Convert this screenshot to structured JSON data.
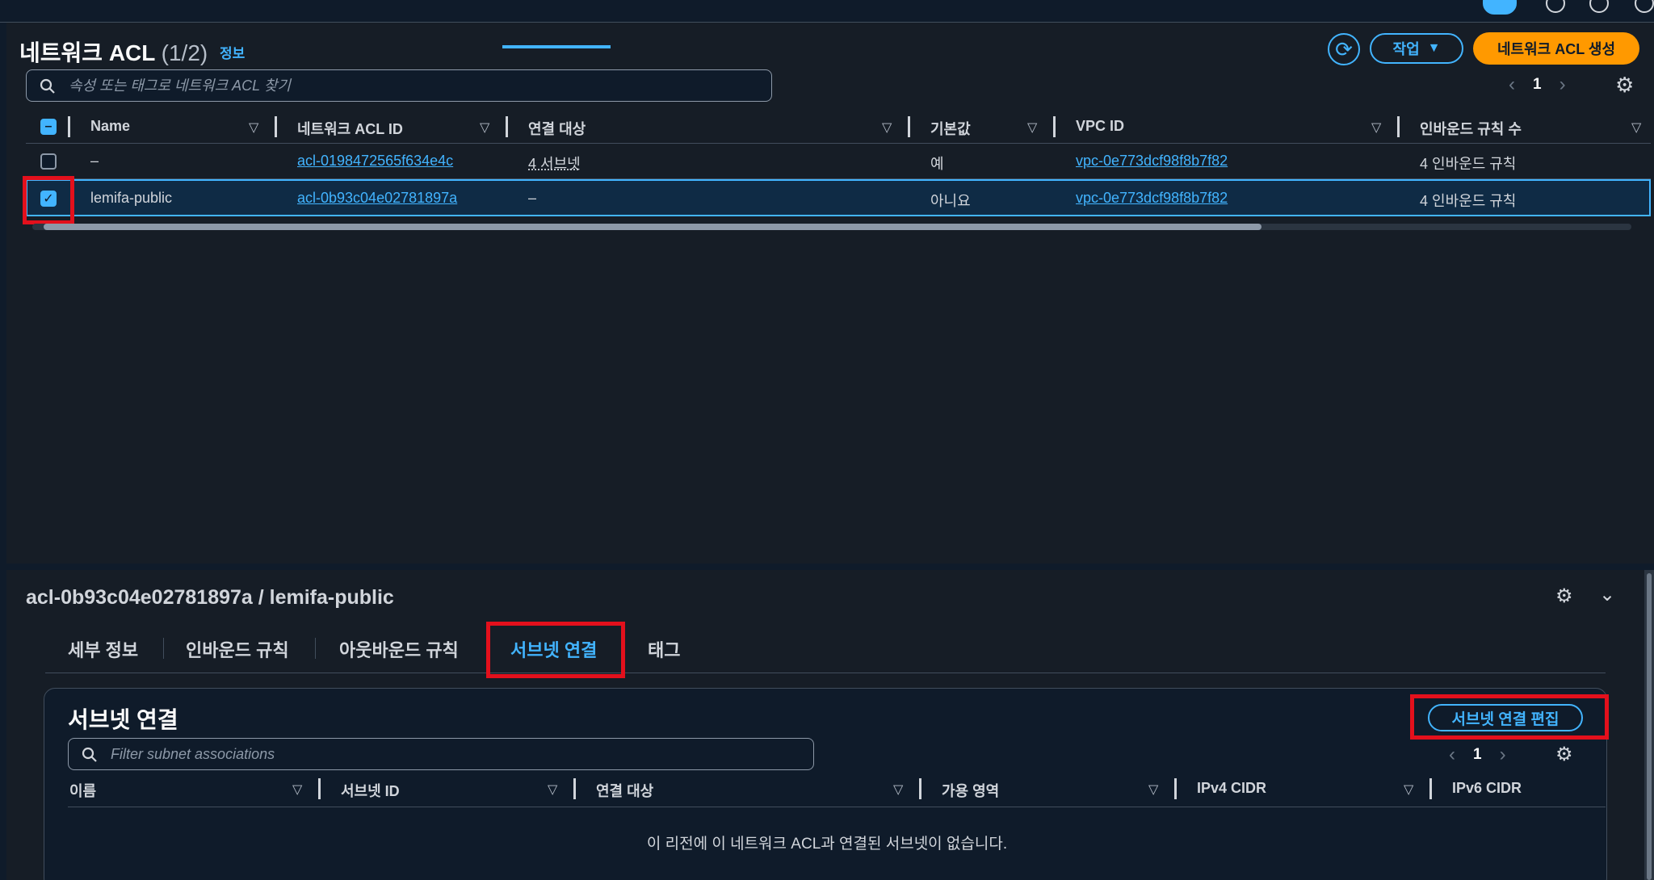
{
  "list": {
    "title": "네트워크 ACL",
    "count": "(1/2)",
    "info_link": "정보",
    "actions_label": "작업",
    "create_label": "네트워크 ACL 생성",
    "search_placeholder": "속성 또는 태그로 네트워크 ACL 찾기",
    "page": "1",
    "columns": [
      "Name",
      "네트워크 ACL ID",
      "연결 대상",
      "기본값",
      "VPC ID",
      "인바운드 규칙 수"
    ],
    "rows": [
      {
        "name": "–",
        "acl_id": "acl-0198472565f634e4c",
        "associated": "4 서브넷",
        "default": "예",
        "vpc_id": "vpc-0e773dcf98f8b7f82",
        "inbound": "4 인바운드 규칙",
        "selected": false
      },
      {
        "name": "lemifa-public",
        "acl_id": "acl-0b93c04e02781897a",
        "associated": "–",
        "default": "아니요",
        "vpc_id": "vpc-0e773dcf98f8b7f82",
        "inbound": "4 인바운드 규칙",
        "selected": true
      }
    ]
  },
  "detail": {
    "title": "acl-0b93c04e02781897a / lemifa-public",
    "tabs": [
      "세부 정보",
      "인바운드 규칙",
      "아웃바운드 규칙",
      "서브넷 연결",
      "태그"
    ],
    "active_tab": "서브넷 연결",
    "section_title": "서브넷 연결",
    "edit_label": "서브넷 연결 편집",
    "filter_placeholder": "Filter subnet associations",
    "page": "1",
    "columns": [
      "이름",
      "서브넷 ID",
      "연결 대상",
      "가용 영역",
      "IPv4 CIDR",
      "IPv6 CIDR"
    ],
    "empty_message": "이 리전에 이 네트워크 ACL과 연결된 서브넷이 없습니다."
  },
  "colors": {
    "background": "#161d26",
    "accent": "#42b4ff",
    "primary_button": "#ff9900",
    "highlight_box": "#e3101c"
  }
}
